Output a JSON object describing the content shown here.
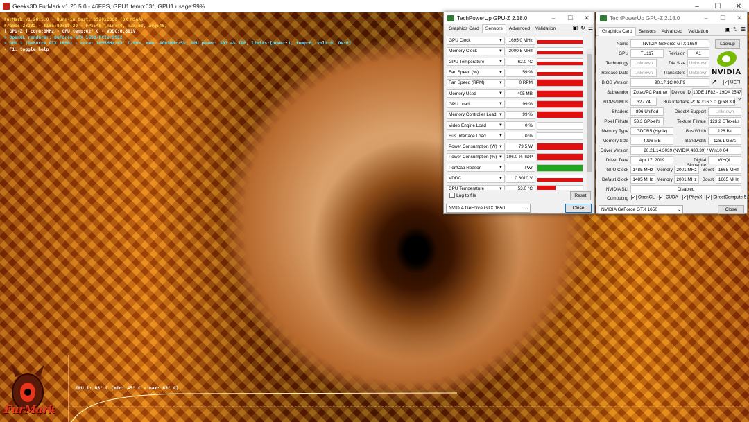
{
  "furmark": {
    "title": "Geeks3D FurMark v1.20.5.0 - 46FPS, GPU1 temp:63°, GPU1 usage:99%",
    "osd": [
      {
        "text": "FurMark v1.20.5.0 - Burn-in test, 1920x1080 (0X MSAA)",
        "color": "y"
      },
      {
        "text": "Frames:26232 - time:00:09:30 - FPS:46 (min:44, max:50, avg:46)",
        "color": "y"
      },
      {
        "text": "[ GPU-Z ] core:0MHz - GPU temp:62° C - VDDC:0.801V",
        "color": "w"
      },
      {
        "text": "> OpenGL renderer: GeForce GTX 1650/PCIe/SSE2",
        "color": "c"
      },
      {
        "text": "> GPU 1 (GeForce GTX 1650) - core: 1695MHz/63° C/99%, mem: 4001MHz/5%, GPU power: 103.4% TDP, limits:[power:1, temp:0, volt:0, OV:0]",
        "color": "c"
      },
      {
        "text": "- F1: toggle help",
        "color": "w"
      }
    ],
    "graph_label": "GPU 1: 63° C (min: 45° C - max: 63° C)",
    "logo_text": "FurMark"
  },
  "gpuz_sensors": {
    "title": "TechPowerUp GPU-Z 2.18.0",
    "tabs": [
      "Graphics Card",
      "Sensors",
      "Advanced",
      "Validation"
    ],
    "active_tab": "Sensors",
    "rows": [
      {
        "name": "GPU Clock",
        "value": "1695.0 MHz",
        "level": 1.0,
        "color": "#e01010",
        "spiky": true
      },
      {
        "name": "Memory Clock",
        "value": "2000.5 MHz",
        "level": 1.0,
        "color": "#e01010",
        "spiky": true
      },
      {
        "name": "GPU Temperature",
        "value": "62.0 °C",
        "level": 1.0,
        "color": "#e01010",
        "spiky": true
      },
      {
        "name": "Fan Speed (%)",
        "value": "59 %",
        "level": 1.0,
        "color": "#e01010",
        "spiky": true
      },
      {
        "name": "Fan Speed (RPM)",
        "value": "0 RPM",
        "level": 1.0,
        "color": "#e01010",
        "spiky": false
      },
      {
        "name": "Memory Used",
        "value": "405 MB",
        "level": 1.0,
        "color": "#e01010",
        "spiky": false
      },
      {
        "name": "GPU Load",
        "value": "99 %",
        "level": 1.0,
        "color": "#e01010",
        "spiky": false
      },
      {
        "name": "Memory Controller Load",
        "value": "99 %",
        "level": 1.0,
        "color": "#e01010",
        "spiky": false
      },
      {
        "name": "Video Engine Load",
        "value": "0 %",
        "level": 0.0,
        "color": "#e01010",
        "spiky": false
      },
      {
        "name": "Bus Interface Load",
        "value": "0 %",
        "level": 0.0,
        "color": "#e01010",
        "spiky": false
      },
      {
        "name": "Power Consumption (W)",
        "value": "79.5 W",
        "level": 1.0,
        "color": "#e01010",
        "spiky": false
      },
      {
        "name": "Power Consumption (%)",
        "value": "106.0 % TDP",
        "level": 1.0,
        "color": "#e01010",
        "spiky": false
      },
      {
        "name": "PerfCap Reason",
        "value": "Pwr",
        "level": 1.0,
        "color": "#1fa81f",
        "spiky": false
      },
      {
        "name": "VDDC",
        "value": "0.8010 V",
        "level": 1.0,
        "color": "#e01010",
        "spiky": true
      },
      {
        "name": "CPU Temperature",
        "value": "53.0 °C",
        "level": 0.4,
        "color": "#e01010",
        "spiky": false
      }
    ],
    "log_label": "Log to file",
    "reset_label": "Reset",
    "gpu_select": "NVIDIA GeForce GTX 1650",
    "close_label": "Close"
  },
  "gpuz_card": {
    "title": "TechPowerUp GPU-Z 2.18.0",
    "tabs": [
      "Graphics Card",
      "Sensors",
      "Advanced",
      "Validation"
    ],
    "active_tab": "Graphics Card",
    "name": "NVIDIA GeForce GTX 1650",
    "lookup_label": "Lookup",
    "gpu": "TU117",
    "revision": "A1",
    "technology": "Unknown",
    "die_size": "Unknown",
    "release_date": "Unknown",
    "transistors": "Unknown",
    "bios_version": "90.17.1C.00.F9",
    "uefi_label": "UEFI",
    "subvendor": "Zotac/PC Partner",
    "device_id": "10DE 1F82 - 19DA 2547",
    "rops_tmus": "32 / 74",
    "bus_interface": "PCIe x16 3.0 @ x8 3.0",
    "shaders": "896 Unified",
    "directx": "Unknown",
    "pixel_fillrate": "53.3 GPixel/s",
    "texture_fillrate": "123.2 GTexel/s",
    "memory_type": "GDDR5 (Hynix)",
    "bus_width": "128 Bit",
    "memory_size": "4096 MB",
    "bandwidth": "128.1 GB/s",
    "driver_version": "26.21.14.3039 (NVIDIA 430.39) / Win10 64",
    "driver_date": "Apr 17, 2019",
    "digital_signature": "WHQL",
    "gpu_clock": "1485 MHz",
    "memory_clock": "2001 MHz",
    "boost_clock": "1665 MHz",
    "default_gpu_clock": "1485 MHz",
    "default_memory_clock": "2001 MHz",
    "default_boost_clock": "1665 MHz",
    "sli": "Disabled",
    "computing": [
      "OpenCL",
      "CUDA",
      "PhysX",
      "DirectCompute 5.0"
    ],
    "labels": {
      "name": "Name",
      "gpu": "GPU",
      "revision": "Revision",
      "technology": "Technology",
      "die_size": "Die Size",
      "release_date": "Release Date",
      "transistors": "Transistors",
      "bios_version": "BIOS Version",
      "subvendor": "Subvendor",
      "device_id": "Device ID",
      "rops_tmus": "ROPs/TMUs",
      "bus_interface": "Bus Interface",
      "shaders": "Shaders",
      "directx": "DirectX Support",
      "pixel_fillrate": "Pixel Fillrate",
      "texture_fillrate": "Texture Fillrate",
      "memory_type": "Memory Type",
      "bus_width": "Bus Width",
      "memory_size": "Memory Size",
      "bandwidth": "Bandwidth",
      "driver_version": "Driver Version",
      "driver_date": "Driver Date",
      "digital_signature": "Digital Signature",
      "gpu_clock": "GPU Clock",
      "default_clock": "Default Clock",
      "memory": "Memory",
      "boost": "Boost",
      "sli": "NVIDIA SLI",
      "computing": "Computing"
    },
    "nvidia_logo": "NVIDIA",
    "gpu_select": "NVIDIA GeForce GTX 1650",
    "close_label": "Close"
  }
}
